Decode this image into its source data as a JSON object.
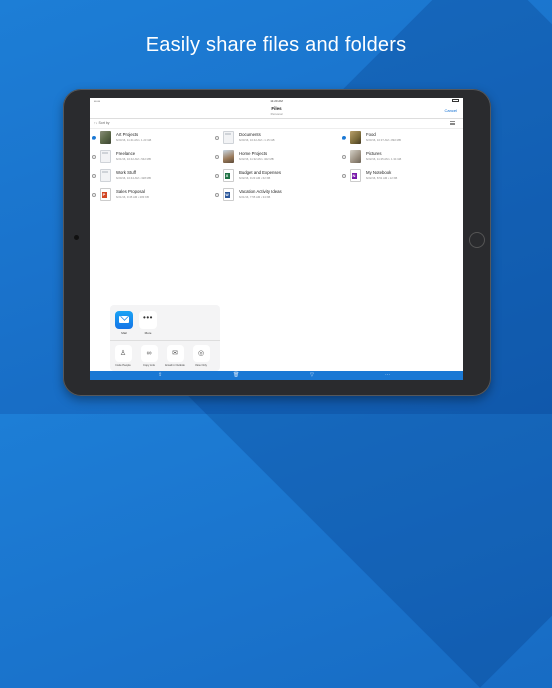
{
  "headline": "Easily share files and folders",
  "status": {
    "time": "11:20 AM",
    "signal": "•••••"
  },
  "navbar": {
    "title": "Files",
    "subtitle": "Personal",
    "cancel": "Cancel"
  },
  "sortbar": {
    "label": "↑↓ Sort by"
  },
  "files": [
    {
      "name": "Art Projects",
      "meta": "6/23/16, 11:41 AM • 1.23 GB",
      "checked": true,
      "thumb": "photo"
    },
    {
      "name": "Freelance",
      "meta": "6/21/16, 10:42 AM • 542 MB",
      "checked": false,
      "thumb": "folder"
    },
    {
      "name": "Work Stuff",
      "meta": "6/20/16, 10:44 AM • 328 MB",
      "checked": false,
      "thumb": "folder"
    },
    {
      "name": "Sales Proposal",
      "meta": "6/21/16, 9:45 AM • 283 KB",
      "checked": false,
      "thumb": "ppt"
    },
    {
      "name": "Documents",
      "meta": "6/23/16, 10:42 AM • 1.15 GB",
      "checked": false,
      "thumb": "folder"
    },
    {
      "name": "Home Projects",
      "meta": "6/22/16, 11:32 AM • 402 MB",
      "checked": false,
      "thumb": "photo2"
    },
    {
      "name": "Budget and Expenses",
      "meta": "6/22/16, 9:23 AM • 62 KB",
      "checked": false,
      "thumb": "xls"
    },
    {
      "name": "Vacation Activity Ideas",
      "meta": "6/21/16, 7:55 AM • 34 KB",
      "checked": false,
      "thumb": "doc"
    },
    {
      "name": "Food",
      "meta": "6/23/16, 10:37 AM • 892 MB",
      "checked": true,
      "thumb": "photo3"
    },
    {
      "name": "Pictures",
      "meta": "6/22/16, 11:25 AM • 1.34 GB",
      "checked": false,
      "thumb": "photo4"
    },
    {
      "name": "My Notebook",
      "meta": "6/22/16, 8:51 AM • 12 KB",
      "checked": false,
      "thumb": "one"
    }
  ],
  "share": {
    "apps": [
      {
        "label": "Mail",
        "icon": "mail-icon"
      },
      {
        "label": "More",
        "icon": "more-icon",
        "glyph": "•••"
      }
    ],
    "actions": [
      {
        "label": "Invite People",
        "icon": "person-icon",
        "glyph": "♙"
      },
      {
        "label": "Copy Link",
        "icon": "link-icon",
        "glyph": "∞"
      },
      {
        "label": "Email in Outlook",
        "icon": "outlook-icon",
        "glyph": "✉"
      },
      {
        "label": "View Only",
        "icon": "eye-icon",
        "glyph": "◎"
      }
    ]
  },
  "toolbar": [
    {
      "icon": "share-icon",
      "glyph": "⇪"
    },
    {
      "icon": "trash-icon",
      "glyph": "🗑"
    },
    {
      "icon": "move-icon",
      "glyph": "▽"
    },
    {
      "icon": "more-icon",
      "glyph": "···"
    }
  ]
}
